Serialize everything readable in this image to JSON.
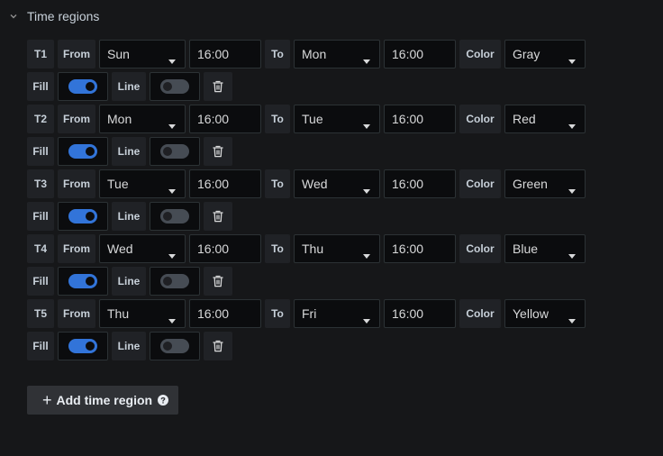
{
  "section": {
    "title": "Time regions"
  },
  "labels": {
    "from": "From",
    "to": "To",
    "color": "Color",
    "fill": "Fill",
    "line": "Line"
  },
  "regions": [
    {
      "id": "T1",
      "from_day": "Sun",
      "from_time": "16:00",
      "to_day": "Mon",
      "to_time": "16:00",
      "color": "Gray",
      "fill": true,
      "line": false
    },
    {
      "id": "T2",
      "from_day": "Mon",
      "from_time": "16:00",
      "to_day": "Tue",
      "to_time": "16:00",
      "color": "Red",
      "fill": true,
      "line": false
    },
    {
      "id": "T3",
      "from_day": "Tue",
      "from_time": "16:00",
      "to_day": "Wed",
      "to_time": "16:00",
      "color": "Green",
      "fill": true,
      "line": false
    },
    {
      "id": "T4",
      "from_day": "Wed",
      "from_time": "16:00",
      "to_day": "Thu",
      "to_time": "16:00",
      "color": "Blue",
      "fill": true,
      "line": false
    },
    {
      "id": "T5",
      "from_day": "Thu",
      "from_time": "16:00",
      "to_day": "Fri",
      "to_time": "16:00",
      "color": "Yellow",
      "fill": true,
      "line": false
    }
  ],
  "add_button": {
    "label": "Add time region"
  },
  "colors": {
    "accent": "#3274d9",
    "background": "#161719"
  }
}
